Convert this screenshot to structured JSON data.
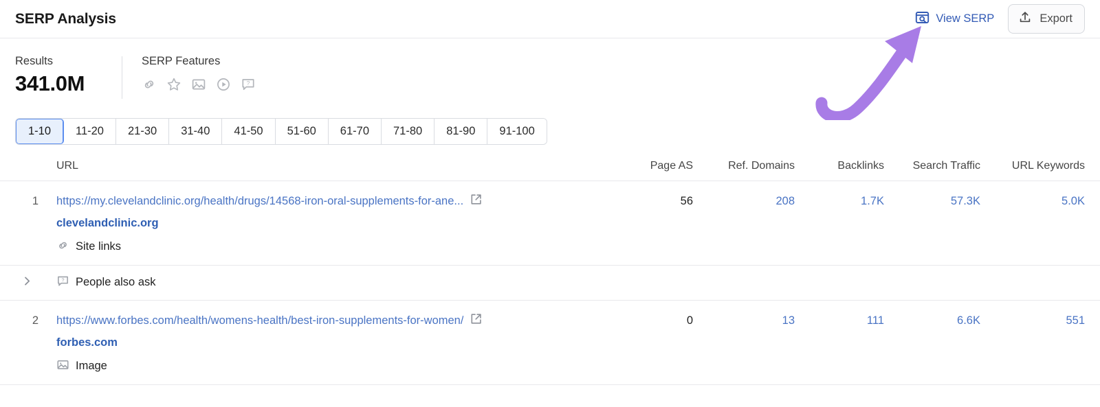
{
  "header": {
    "title": "SERP Analysis",
    "view_serp_label": "View SERP",
    "view_serp_icon": "browser-search-icon",
    "export_label": "Export",
    "export_icon": "upload-icon"
  },
  "summary": {
    "results_label": "Results",
    "results_value": "341.0M",
    "serp_features_label": "SERP Features",
    "serp_feature_icons": [
      {
        "name": "sitelinks-icon",
        "title": "Site links"
      },
      {
        "name": "reviews-star-icon",
        "title": "Reviews"
      },
      {
        "name": "image-icon",
        "title": "Image"
      },
      {
        "name": "video-play-icon",
        "title": "Video"
      },
      {
        "name": "people-also-ask-icon",
        "title": "People also ask"
      }
    ]
  },
  "pagination": {
    "active_index": 0,
    "items": [
      "1-10",
      "11-20",
      "21-30",
      "31-40",
      "41-50",
      "51-60",
      "61-70",
      "71-80",
      "81-90",
      "91-100"
    ]
  },
  "table": {
    "columns": {
      "url": "URL",
      "page_as": "Page AS",
      "ref_domains": "Ref. Domains",
      "backlinks": "Backlinks",
      "search_traffic": "Search Traffic",
      "url_keywords": "URL Keywords"
    },
    "rows": [
      {
        "type": "result",
        "rank": "1",
        "url": "https://my.clevelandclinic.org/health/drugs/14568-iron-oral-supplements-for-ane...",
        "domain": "clevelandclinic.org",
        "feature_label": "Site links",
        "feature_icon": "sitelinks-icon",
        "page_as": "56",
        "ref_domains": "208",
        "backlinks": "1.7K",
        "search_traffic": "57.3K",
        "url_keywords": "5.0K"
      },
      {
        "type": "serp-feature",
        "label": "People also ask",
        "icon": "people-also-ask-icon",
        "expander": "chevron-right-icon"
      },
      {
        "type": "result",
        "rank": "2",
        "url": "https://www.forbes.com/health/womens-health/best-iron-supplements-for-women/",
        "domain": "forbes.com",
        "feature_label": "Image",
        "feature_icon": "image-icon",
        "page_as": "0",
        "ref_domains": "13",
        "backlinks": "111",
        "search_traffic": "6.6K",
        "url_keywords": "551"
      }
    ]
  },
  "annotation": {
    "arrow_color": "#a87ce6",
    "points_to": "View SERP"
  },
  "colors": {
    "link": "#4a74c4",
    "link_strong": "#2f5fb3",
    "accent_purple": "#a87ce6",
    "active_tab_bg": "#e8f0fc",
    "active_tab_border": "#5b8def",
    "border": "#e8e8ec"
  }
}
